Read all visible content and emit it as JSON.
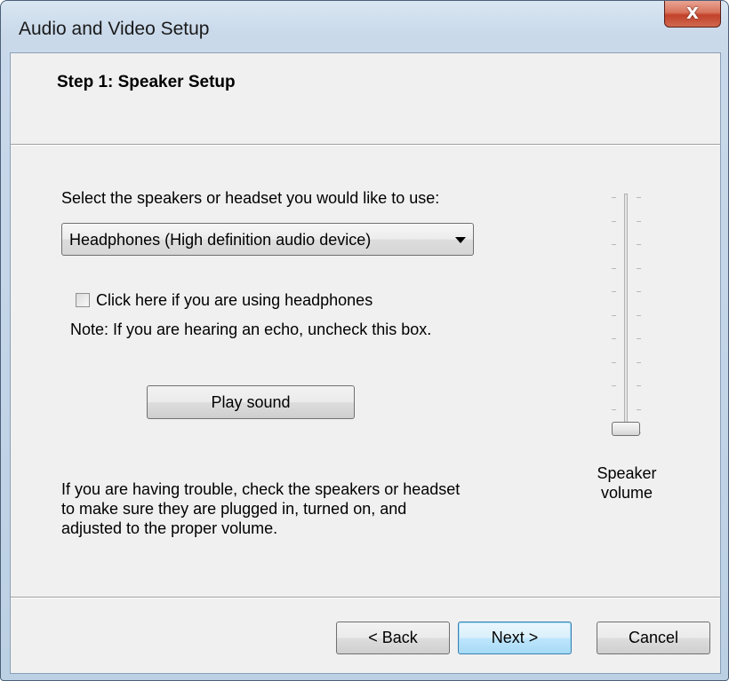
{
  "window": {
    "title": "Audio and Video Setup",
    "close_glyph": "X"
  },
  "header": {
    "step_title": "Step 1: Speaker Setup"
  },
  "speaker": {
    "prompt": "Select the speakers or headset you would like to use:",
    "device_selected": "Headphones (High definition audio device)",
    "headphones_checkbox_label": "Click here if you are using headphones",
    "headphones_checked": false,
    "note": "Note: If you are hearing an echo, uncheck this box.",
    "play_sound_label": "Play sound",
    "trouble_lines": [
      "If you are having trouble, check the speakers or headset",
      "to make sure they are plugged in, turned on, and",
      "adjusted to the proper volume."
    ],
    "volume_label_lines": [
      "Speaker",
      "volume"
    ],
    "volume_level": 0.0
  },
  "footer": {
    "back_label": "< Back",
    "next_label": "Next >",
    "cancel_label": "Cancel"
  },
  "icons": {
    "close": "close-icon",
    "dropdown": "chevron-down-icon"
  }
}
